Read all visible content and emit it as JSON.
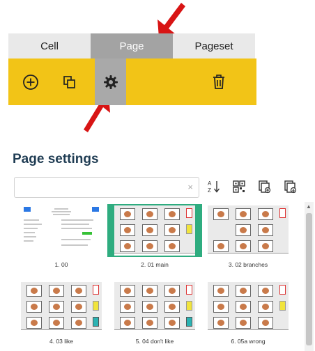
{
  "tabs": [
    {
      "label": "Cell",
      "active": false
    },
    {
      "label": "Page",
      "active": true
    },
    {
      "label": "Pageset",
      "active": false
    }
  ],
  "toolbar": {
    "color": "#f2c417",
    "icons": [
      "add-icon",
      "copy-icon",
      "settings-icon",
      "trash-icon"
    ]
  },
  "heading": "Page settings",
  "search": {
    "value": "",
    "placeholder": "",
    "clear_label": "×"
  },
  "actions": [
    "sort-az-icon",
    "qr-grid-icon",
    "new-page-icon",
    "import-page-icon"
  ],
  "pages": [
    {
      "label": "1. 00",
      "selected": false
    },
    {
      "label": "2. 01 main",
      "selected": true
    },
    {
      "label": "3. 02 branches",
      "selected": false
    },
    {
      "label": "4. 03 like",
      "selected": false
    },
    {
      "label": "5. 04 don't like",
      "selected": false
    },
    {
      "label": "6. 05a wrong",
      "selected": false
    }
  ],
  "colors": {
    "selected": "#2eac7f",
    "arrow": "#d81414",
    "heading": "#1f3c53"
  }
}
